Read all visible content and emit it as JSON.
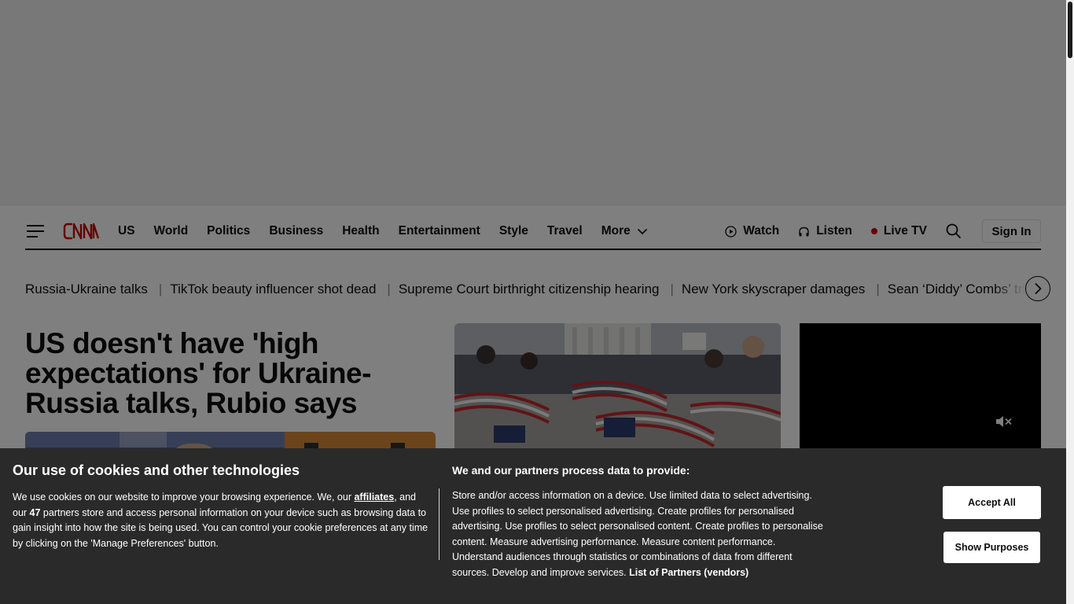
{
  "header": {
    "nav": [
      "US",
      "World",
      "Politics",
      "Business",
      "Health",
      "Entertainment",
      "Style",
      "Travel"
    ],
    "more_label": "More",
    "watch_label": "Watch",
    "listen_label": "Listen",
    "live_tv_label": "Live TV",
    "sign_in_label": "Sign In"
  },
  "trending": [
    "Russia-Ukraine talks",
    "TikTok beauty influencer shot dead",
    "Supreme Court birthright citizenship hearing",
    "New York skyscraper damages",
    "Sean ‘Diddy’ Combs’ trial"
  ],
  "lead": {
    "headline": "US doesn't have 'high expectations' for Ukraine-Russia talks, Rubio says"
  },
  "cookie_banner": {
    "title": "Our use of cookies and other technologies",
    "body_part1": "We use cookies on our website to improve your browsing experience. We, our ",
    "affiliates_link": "affiliates",
    "body_part2": ", and our ",
    "partner_count": "47",
    "body_part3": " partners store and access personal information on your device such as browsing data to gain insight into how the site is being used. You can control your cookie preferences at any time by clicking on the 'Manage Preferences' button.",
    "purposes_title": "We and our partners process data to provide:",
    "purposes_text": "Store and/or access information on a device. Use limited data to select advertising. Use profiles to select personalised advertising. Create profiles for personalised advertising. Use profiles to select personalised content. Create profiles to personalise content. Measure advertising performance. Measure content performance. Understand audiences through statistics or combinations of data from different sources. Develop and improve services.",
    "partners_link": "List of Partners (vendors)",
    "accept_label": "Accept All",
    "show_purposes_label": "Show Purposes"
  },
  "colors": {
    "brand_red": "#cc0000",
    "banner_bg": "#2a2a2a"
  },
  "icons": [
    "hamburger-menu-icon",
    "cnn-logo",
    "chevron-down-icon",
    "play-circle-icon",
    "headphones-icon",
    "live-dot-icon",
    "search-icon",
    "chevron-right-icon",
    "mute-icon"
  ]
}
